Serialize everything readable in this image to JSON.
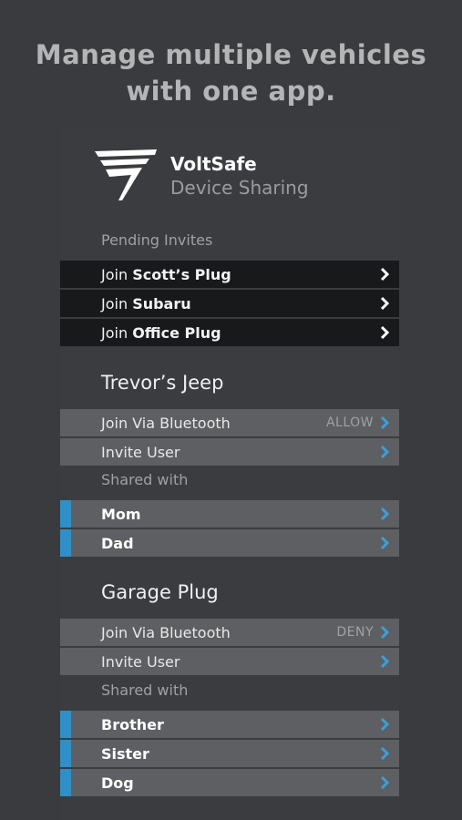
{
  "headline": "Manage multiple vehicles with one app.",
  "brand": {
    "name": "VoltSafe",
    "subtitle": "Device Sharing"
  },
  "pending": {
    "label": "Pending Invites",
    "items": [
      {
        "prefix": "Join",
        "name": "Scott’s Plug"
      },
      {
        "prefix": "Join",
        "name": "Subaru"
      },
      {
        "prefix": "Join",
        "name": "Office Plug"
      }
    ]
  },
  "devices": [
    {
      "title": "Trevor’s Jeep",
      "bluetooth_label": "Join Via Bluetooth",
      "bluetooth_state": "ALLOW",
      "invite_label": "Invite User",
      "shared_label": "Shared with",
      "users": [
        "Mom",
        "Dad"
      ]
    },
    {
      "title": "Garage Plug",
      "bluetooth_label": "Join Via Bluetooth",
      "bluetooth_state": "DENY",
      "invite_label": "Invite User",
      "shared_label": "Shared with",
      "users": [
        "Brother",
        "Sister",
        "Dog"
      ]
    }
  ],
  "colors": {
    "accent": "#2f8fc6",
    "chevron_white": "#ffffff",
    "chevron_blue": "#3aa0dc"
  }
}
